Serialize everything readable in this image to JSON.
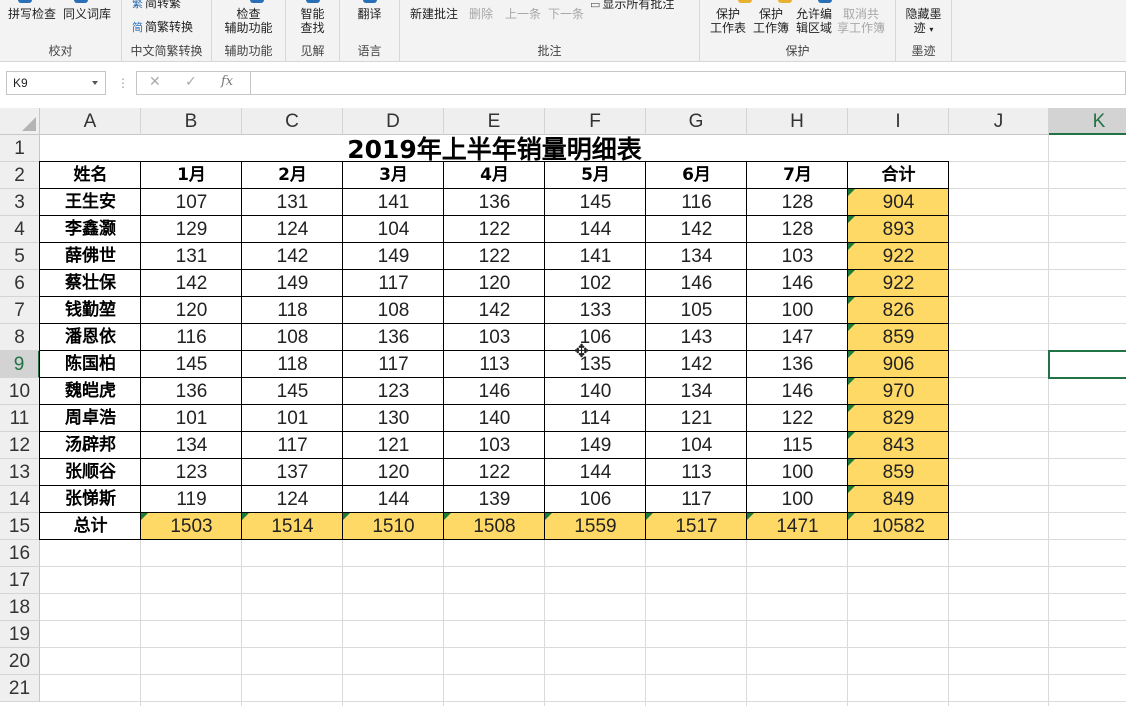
{
  "ribbon": {
    "groups": [
      {
        "label": "校对",
        "buttons": [
          "拼写检查",
          "同义词库"
        ]
      },
      {
        "label": "中文简繁转换",
        "buttons": [
          "简转繁",
          "简繁转换"
        ]
      },
      {
        "label": "辅助功能",
        "buttons": [
          "检查",
          "辅助功能"
        ]
      },
      {
        "label": "见解",
        "buttons": [
          "智能",
          "查找"
        ]
      },
      {
        "label": "语言",
        "buttons": [
          "翻译"
        ]
      },
      {
        "label": "批注",
        "buttons": [
          "新建批注",
          "删除",
          "上一条",
          "下一条",
          "显示所有批注"
        ]
      },
      {
        "label": "保护",
        "buttons": [
          "保护",
          "工作表",
          "保护",
          "工作簿",
          "允许编",
          "辑区域",
          "取消共",
          "享工作簿"
        ]
      },
      {
        "label": "墨迹",
        "buttons": [
          "隐藏墨",
          "迹"
        ]
      }
    ]
  },
  "formula_bar": {
    "name_box": "K9",
    "fx": "fx",
    "cancel": "✕",
    "enter": "✓",
    "formula": ""
  },
  "columns": [
    "A",
    "B",
    "C",
    "D",
    "E",
    "F",
    "G",
    "H",
    "I",
    "J",
    "K"
  ],
  "rows": [
    "1",
    "2",
    "3",
    "4",
    "5",
    "6",
    "7",
    "8",
    "9",
    "10",
    "11",
    "12",
    "13",
    "14",
    "15",
    "16",
    "17",
    "18",
    "19",
    "20",
    "21"
  ],
  "sheet": {
    "title": "2019年上半年销量明细表",
    "header": [
      "姓名",
      "1月",
      "2月",
      "3月",
      "4月",
      "5月",
      "6月",
      "7月",
      "合计"
    ],
    "data": [
      [
        "王生安",
        "107",
        "131",
        "141",
        "136",
        "145",
        "116",
        "128",
        "904"
      ],
      [
        "李鑫灏",
        "129",
        "124",
        "104",
        "122",
        "144",
        "142",
        "128",
        "893"
      ],
      [
        "薛佛世",
        "131",
        "142",
        "149",
        "122",
        "141",
        "134",
        "103",
        "922"
      ],
      [
        "蔡壮保",
        "142",
        "149",
        "117",
        "120",
        "102",
        "146",
        "146",
        "922"
      ],
      [
        "钱勤堃",
        "120",
        "118",
        "108",
        "142",
        "133",
        "105",
        "100",
        "826"
      ],
      [
        "潘恩依",
        "116",
        "108",
        "136",
        "103",
        "106",
        "143",
        "147",
        "859"
      ],
      [
        "陈国柏",
        "145",
        "118",
        "117",
        "113",
        "135",
        "142",
        "136",
        "906"
      ],
      [
        "魏皑虎",
        "136",
        "145",
        "123",
        "146",
        "140",
        "134",
        "146",
        "970"
      ],
      [
        "周卓浩",
        "101",
        "101",
        "130",
        "140",
        "114",
        "121",
        "122",
        "829"
      ],
      [
        "汤辟邦",
        "134",
        "117",
        "121",
        "103",
        "149",
        "104",
        "115",
        "843"
      ],
      [
        "张顺谷",
        "123",
        "137",
        "120",
        "122",
        "144",
        "113",
        "100",
        "859"
      ],
      [
        "张悌斯",
        "119",
        "124",
        "144",
        "139",
        "106",
        "117",
        "100",
        "849"
      ]
    ],
    "total_row": [
      "总计",
      "1503",
      "1514",
      "1510",
      "1508",
      "1559",
      "1517",
      "1471",
      "10582"
    ]
  },
  "selected_cell": {
    "column": "K",
    "row": "9"
  },
  "colors": {
    "total_fill": "#ffd966",
    "selection": "#217346",
    "formula_flag": "#1e7b3a"
  }
}
